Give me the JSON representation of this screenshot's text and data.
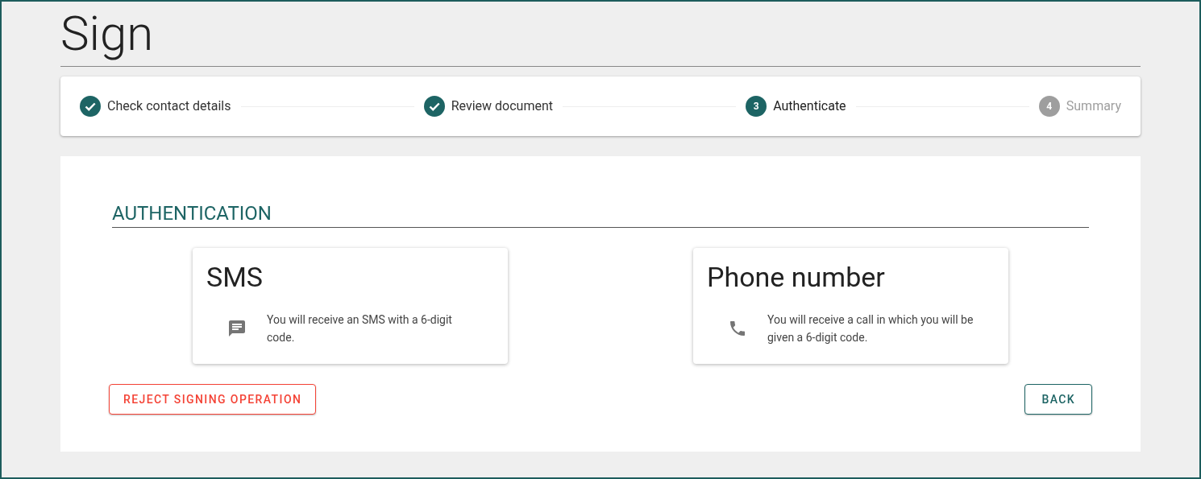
{
  "page": {
    "title": "Sign"
  },
  "steps": [
    {
      "label": "Check contact details",
      "completed": true,
      "active": false
    },
    {
      "label": "Review document",
      "completed": true,
      "active": false
    },
    {
      "label": "Authenticate",
      "completed": false,
      "active": true,
      "number": "3"
    },
    {
      "label": "Summary",
      "completed": false,
      "active": false,
      "number": "4"
    }
  ],
  "section": {
    "heading": "AUTHENTICATION"
  },
  "methods": [
    {
      "kind": "sms",
      "title": "SMS",
      "description": "You will receive an SMS with a 6-digit code."
    },
    {
      "kind": "phone",
      "title": "Phone number",
      "description": "You will receive a call in which you will be given a 6-digit code."
    }
  ],
  "buttons": {
    "reject": "REJECT SIGNING OPERATION",
    "back": "BACK"
  }
}
